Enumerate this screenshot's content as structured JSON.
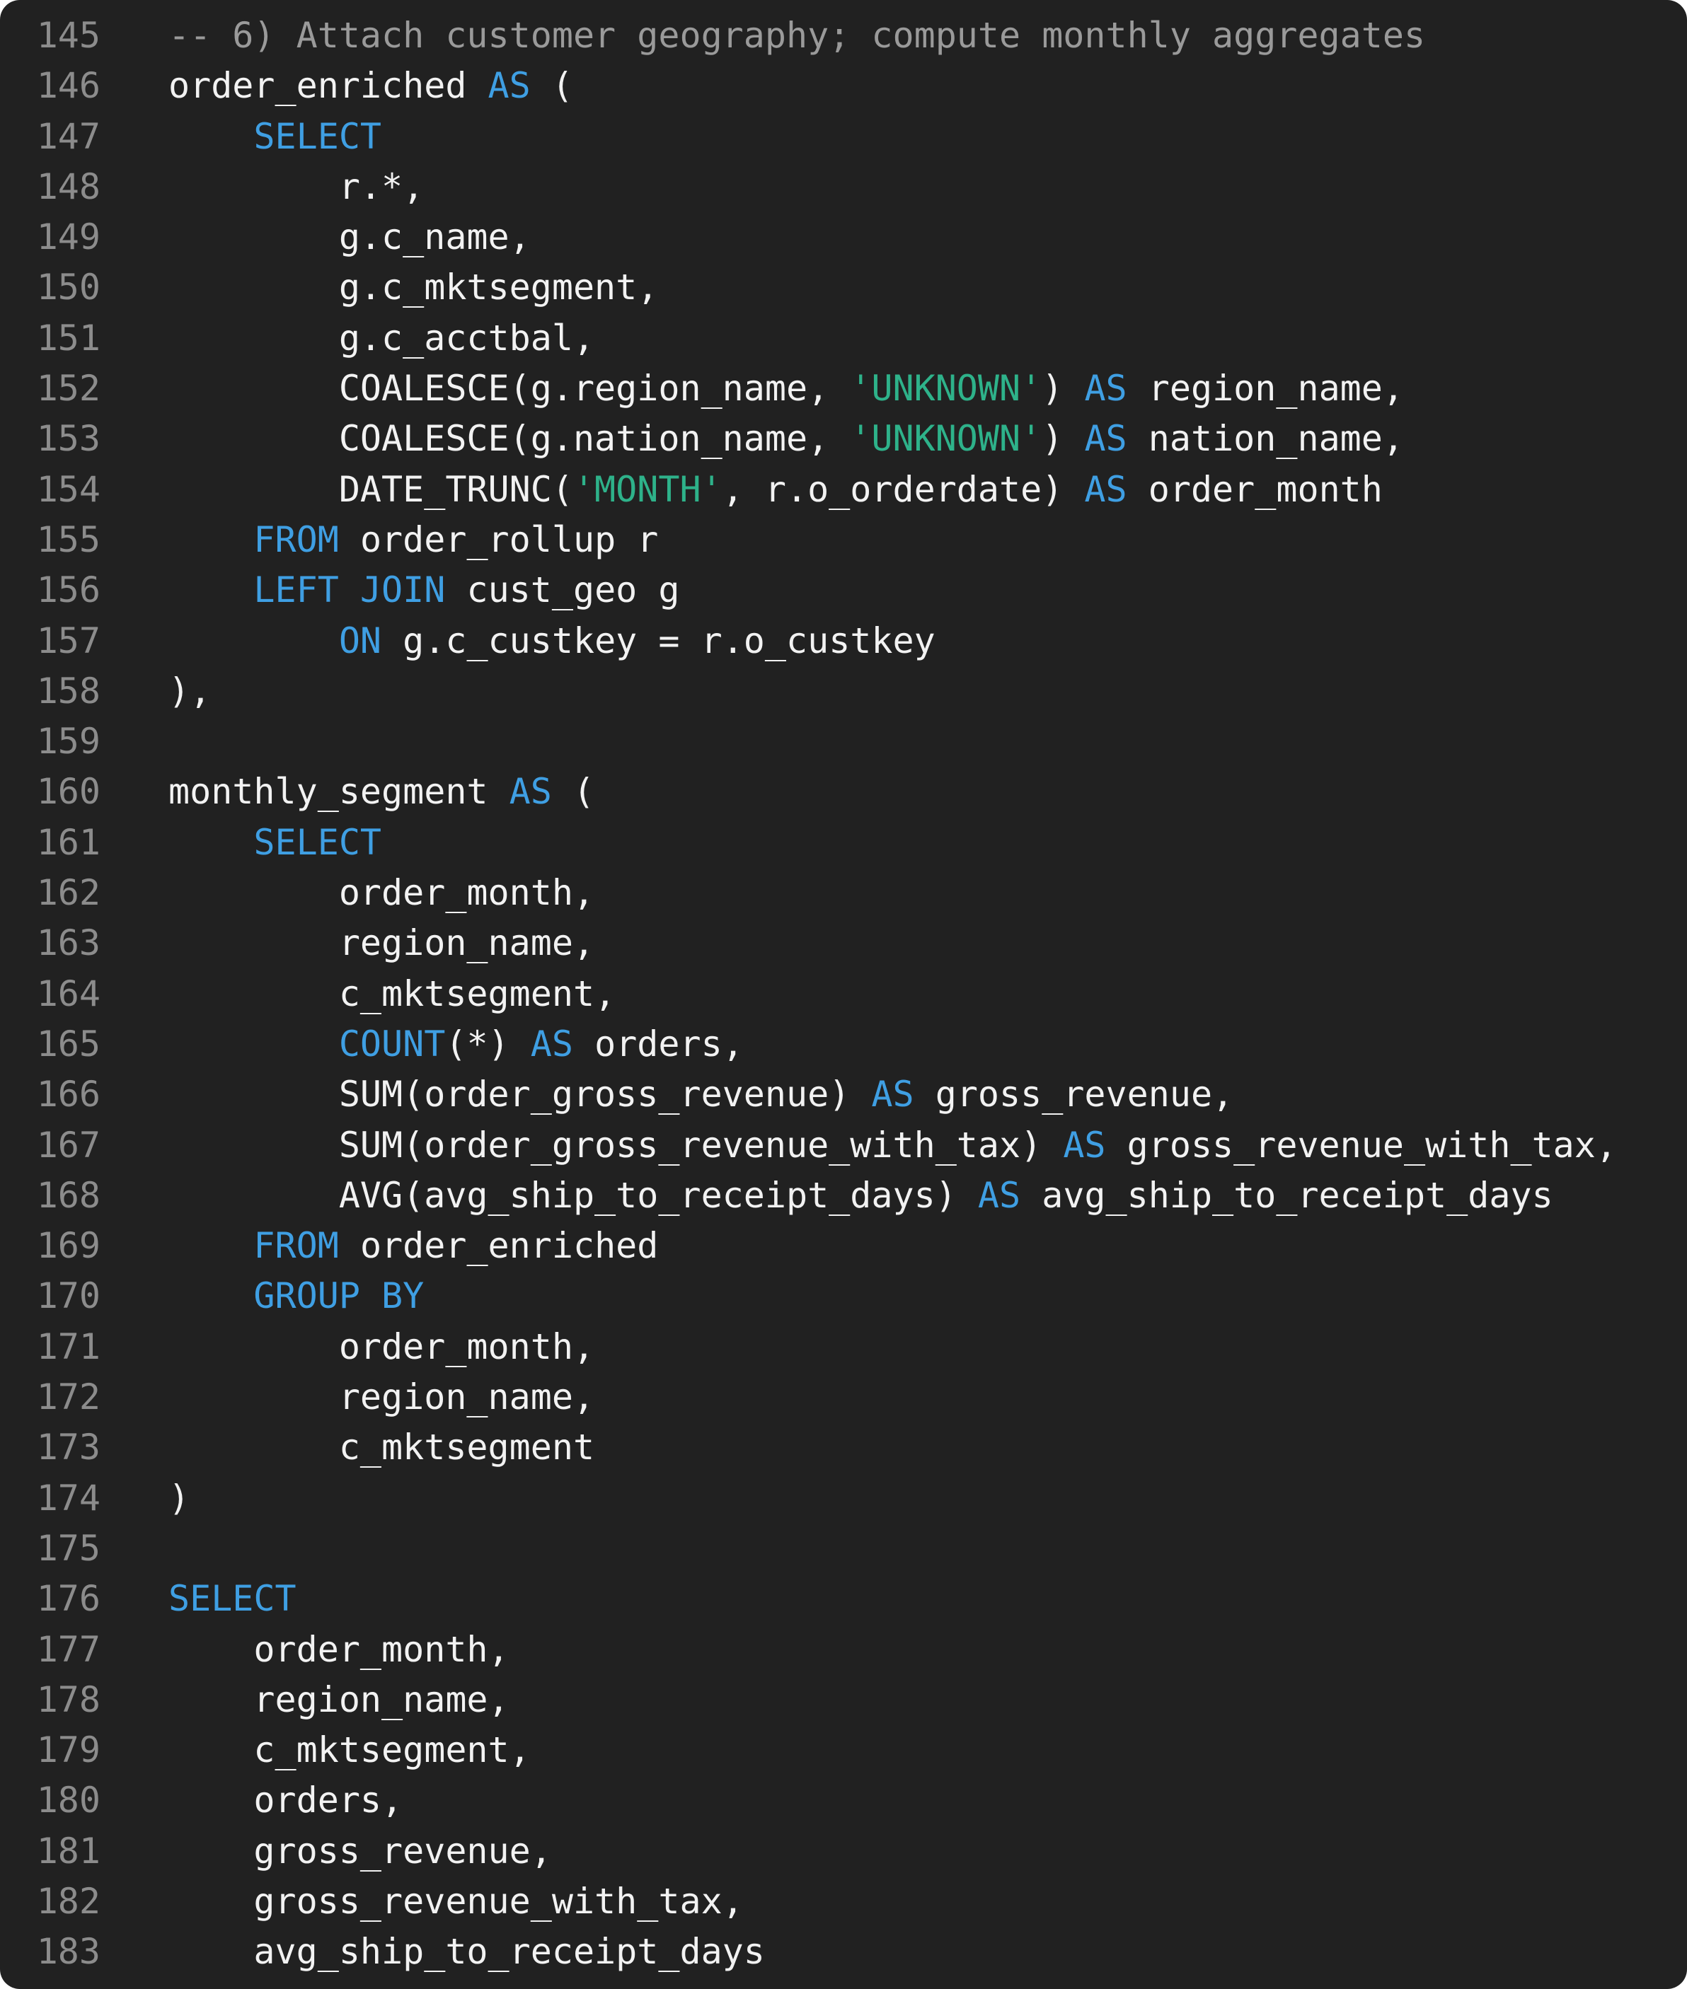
{
  "editor": {
    "colors": {
      "background": "#212121",
      "text": "#f2f2f2",
      "keyword": "#3f9fe3",
      "string": "#2eb28a",
      "comment": "#9a9a9a",
      "line_number": "#8c8c8c"
    },
    "lines": [
      {
        "n": "145",
        "tokens": [
          {
            "t": "cm",
            "v": "-- 6) Attach customer geography; compute monthly aggregates"
          }
        ]
      },
      {
        "n": "146",
        "tokens": [
          {
            "t": "id",
            "v": "order_enriched "
          },
          {
            "t": "kw",
            "v": "AS"
          },
          {
            "t": "id",
            "v": " ("
          }
        ]
      },
      {
        "n": "147",
        "tokens": [
          {
            "t": "id",
            "v": "    "
          },
          {
            "t": "kw",
            "v": "SELECT"
          }
        ]
      },
      {
        "n": "148",
        "tokens": [
          {
            "t": "id",
            "v": "        r.*,"
          }
        ]
      },
      {
        "n": "149",
        "tokens": [
          {
            "t": "id",
            "v": "        g.c_name,"
          }
        ]
      },
      {
        "n": "150",
        "tokens": [
          {
            "t": "id",
            "v": "        g.c_mktsegment,"
          }
        ]
      },
      {
        "n": "151",
        "tokens": [
          {
            "t": "id",
            "v": "        g.c_acctbal,"
          }
        ]
      },
      {
        "n": "152",
        "tokens": [
          {
            "t": "id",
            "v": "        COALESCE(g.region_name, "
          },
          {
            "t": "str",
            "v": "'UNKNOWN'"
          },
          {
            "t": "id",
            "v": ") "
          },
          {
            "t": "kw",
            "v": "AS"
          },
          {
            "t": "id",
            "v": " region_name,"
          }
        ]
      },
      {
        "n": "153",
        "tokens": [
          {
            "t": "id",
            "v": "        COALESCE(g.nation_name, "
          },
          {
            "t": "str",
            "v": "'UNKNOWN'"
          },
          {
            "t": "id",
            "v": ") "
          },
          {
            "t": "kw",
            "v": "AS"
          },
          {
            "t": "id",
            "v": " nation_name,"
          }
        ]
      },
      {
        "n": "154",
        "tokens": [
          {
            "t": "id",
            "v": "        DATE_TRUNC("
          },
          {
            "t": "str",
            "v": "'MONTH'"
          },
          {
            "t": "id",
            "v": ", r.o_orderdate) "
          },
          {
            "t": "kw",
            "v": "AS"
          },
          {
            "t": "id",
            "v": " order_month"
          }
        ]
      },
      {
        "n": "155",
        "tokens": [
          {
            "t": "id",
            "v": "    "
          },
          {
            "t": "kw",
            "v": "FROM"
          },
          {
            "t": "id",
            "v": " order_rollup r"
          }
        ]
      },
      {
        "n": "156",
        "tokens": [
          {
            "t": "id",
            "v": "    "
          },
          {
            "t": "kw",
            "v": "LEFT JOIN"
          },
          {
            "t": "id",
            "v": " cust_geo g"
          }
        ]
      },
      {
        "n": "157",
        "tokens": [
          {
            "t": "id",
            "v": "        "
          },
          {
            "t": "kw",
            "v": "ON"
          },
          {
            "t": "id",
            "v": " g.c_custkey = r.o_custkey"
          }
        ]
      },
      {
        "n": "158",
        "tokens": [
          {
            "t": "id",
            "v": "),"
          }
        ]
      },
      {
        "n": "159",
        "tokens": []
      },
      {
        "n": "160",
        "tokens": [
          {
            "t": "id",
            "v": "monthly_segment "
          },
          {
            "t": "kw",
            "v": "AS"
          },
          {
            "t": "id",
            "v": " ("
          }
        ]
      },
      {
        "n": "161",
        "tokens": [
          {
            "t": "id",
            "v": "    "
          },
          {
            "t": "kw",
            "v": "SELECT"
          }
        ]
      },
      {
        "n": "162",
        "tokens": [
          {
            "t": "id",
            "v": "        order_month,"
          }
        ]
      },
      {
        "n": "163",
        "tokens": [
          {
            "t": "id",
            "v": "        region_name,"
          }
        ]
      },
      {
        "n": "164",
        "tokens": [
          {
            "t": "id",
            "v": "        c_mktsegment,"
          }
        ]
      },
      {
        "n": "165",
        "tokens": [
          {
            "t": "id",
            "v": "        "
          },
          {
            "t": "kw",
            "v": "COUNT"
          },
          {
            "t": "id",
            "v": "(*) "
          },
          {
            "t": "kw",
            "v": "AS"
          },
          {
            "t": "id",
            "v": " orders,"
          }
        ]
      },
      {
        "n": "166",
        "tokens": [
          {
            "t": "id",
            "v": "        SUM(order_gross_revenue) "
          },
          {
            "t": "kw",
            "v": "AS"
          },
          {
            "t": "id",
            "v": " gross_revenue,"
          }
        ]
      },
      {
        "n": "167",
        "tokens": [
          {
            "t": "id",
            "v": "        SUM(order_gross_revenue_with_tax) "
          },
          {
            "t": "kw",
            "v": "AS"
          },
          {
            "t": "id",
            "v": " gross_revenue_with_tax,"
          }
        ]
      },
      {
        "n": "168",
        "tokens": [
          {
            "t": "id",
            "v": "        AVG(avg_ship_to_receipt_days) "
          },
          {
            "t": "kw",
            "v": "AS"
          },
          {
            "t": "id",
            "v": " avg_ship_to_receipt_days"
          }
        ]
      },
      {
        "n": "169",
        "tokens": [
          {
            "t": "id",
            "v": "    "
          },
          {
            "t": "kw",
            "v": "FROM"
          },
          {
            "t": "id",
            "v": " order_enriched"
          }
        ]
      },
      {
        "n": "170",
        "tokens": [
          {
            "t": "id",
            "v": "    "
          },
          {
            "t": "kw",
            "v": "GROUP BY"
          }
        ]
      },
      {
        "n": "171",
        "tokens": [
          {
            "t": "id",
            "v": "        order_month,"
          }
        ]
      },
      {
        "n": "172",
        "tokens": [
          {
            "t": "id",
            "v": "        region_name,"
          }
        ]
      },
      {
        "n": "173",
        "tokens": [
          {
            "t": "id",
            "v": "        c_mktsegment"
          }
        ]
      },
      {
        "n": "174",
        "tokens": [
          {
            "t": "id",
            "v": ")"
          }
        ]
      },
      {
        "n": "175",
        "tokens": []
      },
      {
        "n": "176",
        "tokens": [
          {
            "t": "kw",
            "v": "SELECT"
          }
        ]
      },
      {
        "n": "177",
        "tokens": [
          {
            "t": "id",
            "v": "    order_month,"
          }
        ]
      },
      {
        "n": "178",
        "tokens": [
          {
            "t": "id",
            "v": "    region_name,"
          }
        ]
      },
      {
        "n": "179",
        "tokens": [
          {
            "t": "id",
            "v": "    c_mktsegment,"
          }
        ]
      },
      {
        "n": "180",
        "tokens": [
          {
            "t": "id",
            "v": "    orders,"
          }
        ]
      },
      {
        "n": "181",
        "tokens": [
          {
            "t": "id",
            "v": "    gross_revenue,"
          }
        ]
      },
      {
        "n": "182",
        "tokens": [
          {
            "t": "id",
            "v": "    gross_revenue_with_tax,"
          }
        ]
      },
      {
        "n": "183",
        "tokens": [
          {
            "t": "id",
            "v": "    avg_ship_to_receipt_days"
          }
        ]
      }
    ]
  }
}
